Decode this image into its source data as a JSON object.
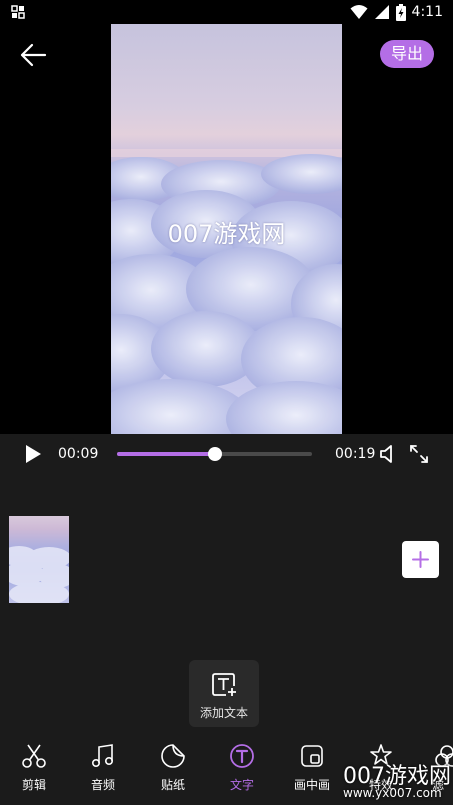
{
  "status_bar": {
    "time": "4:11"
  },
  "preview": {
    "overlay_text": "007游戏网",
    "export_label": "导出"
  },
  "playback": {
    "current_time": "00:09",
    "total_time": "00:19",
    "progress": 0.5
  },
  "editor": {
    "add_text_label": "添加文本"
  },
  "toolbar": {
    "items": [
      {
        "label": "剪辑",
        "icon": "scissors-icon"
      },
      {
        "label": "音频",
        "icon": "music-note-icon"
      },
      {
        "label": "贴纸",
        "icon": "sticker-icon"
      },
      {
        "label": "文字",
        "icon": "text-icon",
        "active": true
      },
      {
        "label": "画中画",
        "icon": "picture-in-picture-icon"
      },
      {
        "label": "特效",
        "icon": "effects-icon"
      },
      {
        "label": "滤",
        "icon": "filter-icon"
      }
    ]
  },
  "watermark": {
    "text": "007游戏网",
    "url": "www.yx007.com"
  },
  "colors": {
    "accent": "#b46ee6",
    "panel": "#1b1b1b"
  }
}
